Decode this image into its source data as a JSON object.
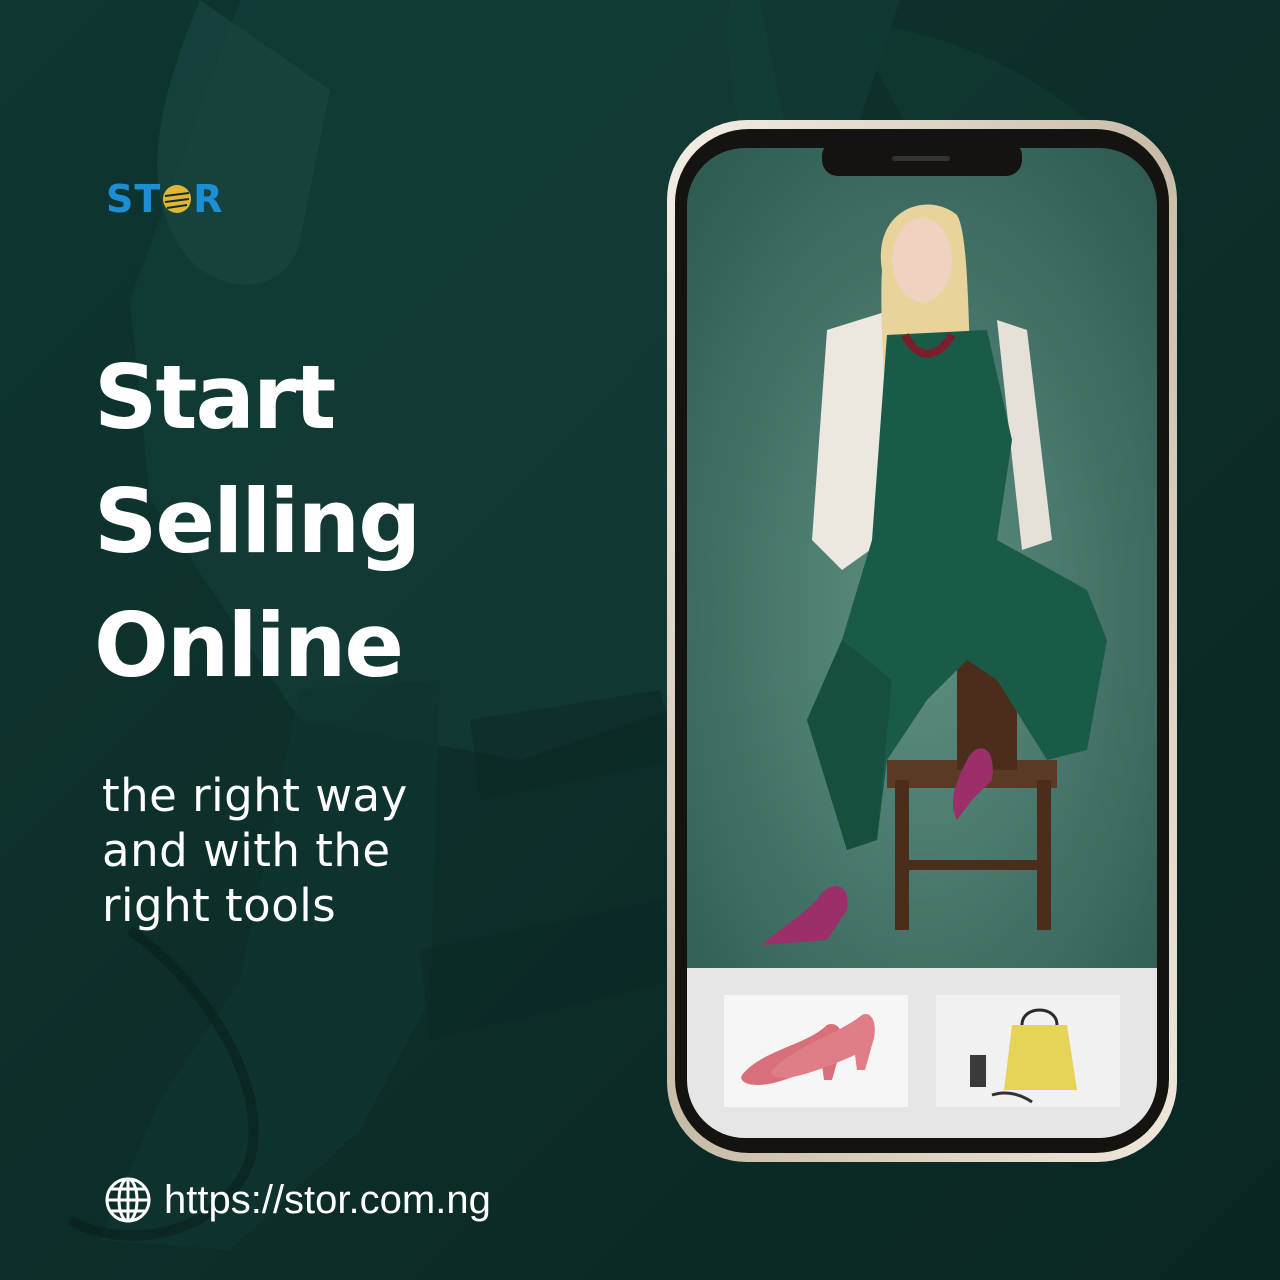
{
  "brand": {
    "logo_text_left": "ST",
    "logo_text_right": "R",
    "color": "#1b8fd6"
  },
  "headline": {
    "line1": "Start",
    "line2": "Selling",
    "line3": "Online"
  },
  "subheadline": {
    "line1": "the right way",
    "line2": "and with the",
    "line3": "right tools"
  },
  "footer": {
    "url": "https://stor.com.ng",
    "icon": "globe-icon"
  },
  "colors": {
    "background": "#0d2e2a",
    "text": "#ffffff",
    "accent_gold": "#e3b535",
    "dress": "#1a5a48"
  }
}
